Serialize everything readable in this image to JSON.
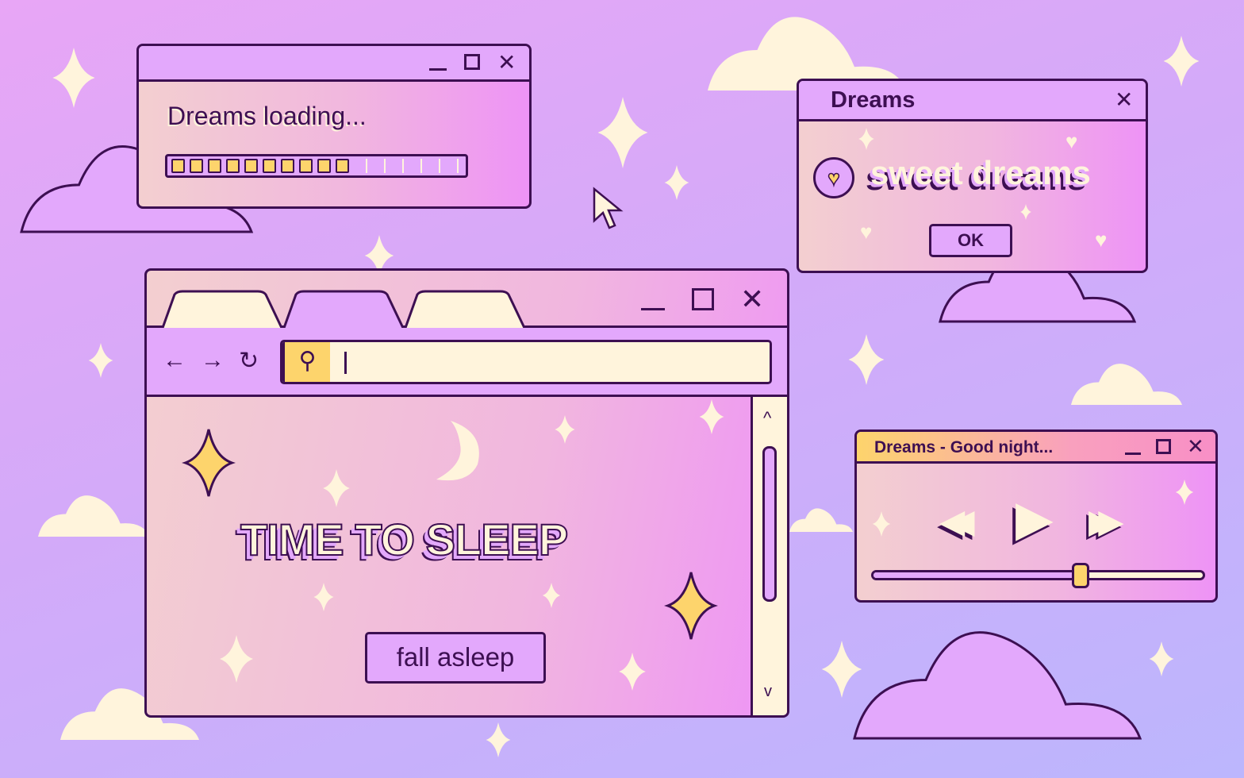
{
  "colors": {
    "outline": "#3d0f52",
    "lavender": "#e3a8fc",
    "cream": "#fff4dc",
    "yellow": "#fdd46c",
    "pink": "#ee93f6"
  },
  "loading_window": {
    "title_controls": [
      "minimize",
      "maximize",
      "close"
    ],
    "message": "Dreams loading...",
    "progress": {
      "filled_segments": 10,
      "total_segments": 16,
      "percent": 62
    }
  },
  "dialog": {
    "title": "Dreams",
    "close_icon": "close-icon",
    "icon": "heart-icon",
    "message": "sweet dreams",
    "ok_label": "OK"
  },
  "browser": {
    "tabs": [
      {
        "active": false
      },
      {
        "active": true
      },
      {
        "active": false
      }
    ],
    "nav": {
      "back": "←",
      "forward": "→",
      "reload": "↻"
    },
    "address": {
      "value": "",
      "search_icon": "search-icon"
    },
    "content": {
      "headline": "TIME TO SLEEP",
      "button_label": "fall asleep"
    },
    "scrollbar": {
      "up": "^",
      "down": "v"
    }
  },
  "player": {
    "title": "Dreams - Good night...",
    "controls": [
      "rewind",
      "play",
      "fast-forward"
    ],
    "progress_percent": 63
  }
}
